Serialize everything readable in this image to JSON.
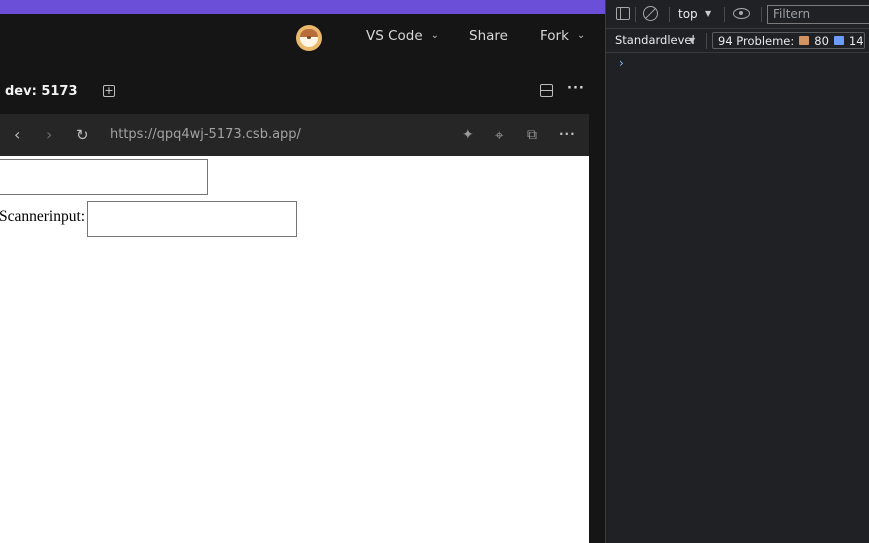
{
  "codesandbox": {
    "top_bar": {
      "avatar_icon": "user-avatar",
      "vscode_label": "VS Code",
      "share_label": "Share",
      "fork_label": "Fork"
    },
    "tab": {
      "label": "dev: 5173",
      "add_icon": "plus-square-icon",
      "split_icon": "layout-split-icon",
      "more_icon": "more-horizontal-icon"
    },
    "browser": {
      "url": "https://qpq4wj-5173.csb.app/",
      "back_icon": "chevron-left-icon",
      "forward_icon": "chevron-right-icon",
      "reload_icon": "refresh-icon",
      "tools": [
        "sparkle-icon",
        "crosshair-icon",
        "open-window-icon",
        "more-horizontal-icon"
      ]
    },
    "preview": {
      "scanner_label": "Scannerinput:",
      "top_input_value": "",
      "scanner_input_value": ""
    }
  },
  "devtools": {
    "context_label": "top",
    "filter_placeholder": "Filtern",
    "level_label": "Standardlevel",
    "issues_label": "94 Probleme:",
    "warnings_count": "80",
    "info_count": "14",
    "prompt_symbol": "›"
  },
  "colors": {
    "accent_purple": "#6b4fd8",
    "warning": "#d59361",
    "info": "#6d9cff"
  }
}
